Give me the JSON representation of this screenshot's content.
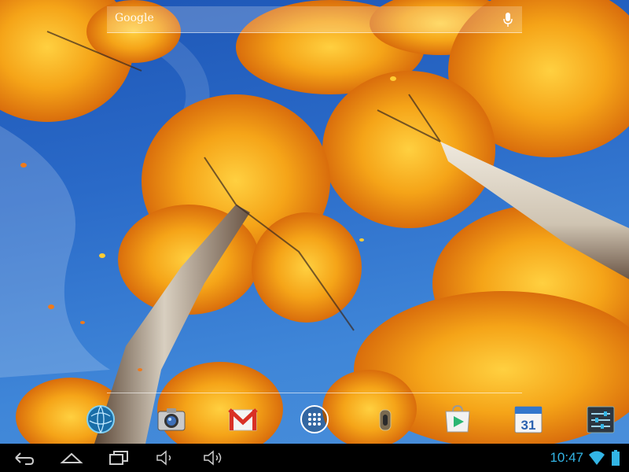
{
  "search": {
    "logo": "Google",
    "mic_icon": "mic-icon"
  },
  "dock": {
    "apps": [
      {
        "icon": "browser-globe-icon"
      },
      {
        "icon": "camera-icon"
      },
      {
        "icon": "gmail-icon"
      },
      {
        "icon": "all-apps-icon"
      },
      {
        "icon": "settings-slider-icon"
      },
      {
        "icon": "play-store-icon"
      },
      {
        "icon": "calendar-icon",
        "label": "31"
      },
      {
        "icon": "settings-icon"
      }
    ]
  },
  "navbar": {
    "buttons": [
      "back-icon",
      "home-icon",
      "recents-icon",
      "volume-down-icon",
      "volume-up-icon"
    ],
    "time": "10:47",
    "status_icons": [
      "wifi-icon",
      "battery-icon"
    ]
  },
  "colors": {
    "clock": "#33b5e5",
    "sky": "#2a6ac8",
    "foliage": "#f0a020"
  }
}
